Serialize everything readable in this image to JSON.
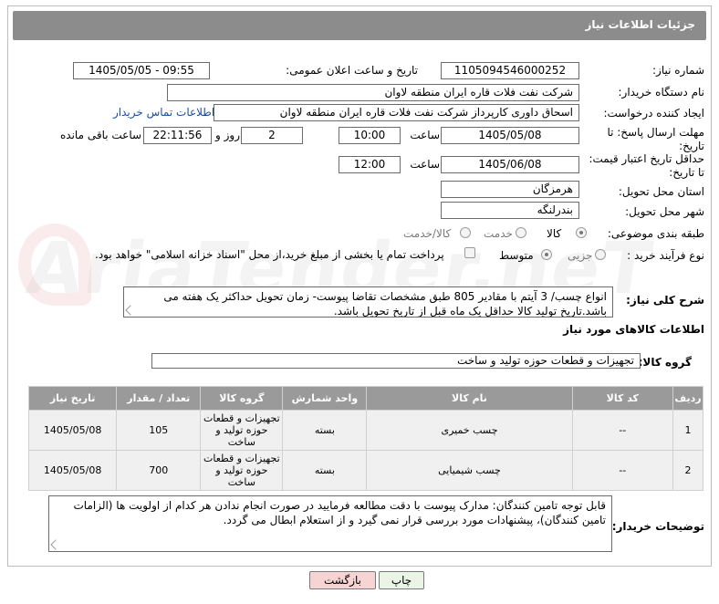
{
  "header": {
    "title": "جزئیات اطلاعات نیاز"
  },
  "labels": {
    "need_number": "شماره نیاز:",
    "announce_datetime": "تاریخ و ساعت اعلان عمومی:",
    "buyer_org": "نام دستگاه خریدار:",
    "requester": "ایجاد کننده درخواست:",
    "reply_deadline_l1": "مهلت ارسال پاسخ: تا",
    "reply_deadline_l2": "تاریخ:",
    "validity_l1": "حداقل تاریخ اعتبار قیمت:",
    "validity_l2": "تا تاریخ:",
    "time": "ساعت",
    "day_and": "روز و",
    "hours_left": "ساعت باقی مانده",
    "delivery_province": "استان محل تحویل:",
    "delivery_city": "شهر محل تحویل:",
    "category": "طبقه بندی موضوعی:",
    "purchase_type": "نوع فرآیند خرید :",
    "general_desc": "شرح کلی نیاز:",
    "goods_info": "اطلاعات کالاهای مورد نیاز",
    "goods_group": "گروه کالا:",
    "buyer_notes": "توضیحات خریدار:"
  },
  "values": {
    "need_number": "1105094546000252",
    "announce_datetime": "1405/05/05 - 09:55",
    "buyer_org": "شرکت نفت فلات قاره ایران منطقه لاوان",
    "requester": "اسحاق داوری کارپرداز شرکت نفت فلات قاره ایران منطقه لاوان",
    "buyer_contact_link": "اطلاعات تماس خریدار",
    "reply_date": "1405/05/08",
    "reply_time": "10:00",
    "reply_days": "2",
    "reply_remaining": "22:11:56",
    "validity_date": "1405/06/08",
    "validity_time": "12:00",
    "delivery_province": "هرمزگان",
    "delivery_city": "بندرلنگه",
    "goods_group": "تجهیزات و قطعات حوزه تولید و ساخت",
    "general_desc": "انواع چسب/ 3 آیتم با مقادیر 805 طبق مشخصات تقاضا پیوست- زمان تحویل حداکثر یک هفته می باشد.تاریخ تولید کالا حداقل یک ماه قبل از تاریخ تحویل باشد.",
    "buyer_notes": "قابل توجه تامین کنندگان: مدارک پیوست با دقت مطالعه فرمایید در صورت انجام ندادن هر کدام از اولویت ها (الزامات تامین کنندگان)، پیشنهادات مورد بررسی قرار نمی گیرد و از استعلام ابطال می گردد."
  },
  "category_options": [
    {
      "label": "کالا",
      "selected": true
    },
    {
      "label": "خدمت",
      "selected": false
    },
    {
      "label": "کالا/خدمت",
      "selected": false
    }
  ],
  "purchase_options": [
    {
      "label": "جزیی",
      "selected": false
    },
    {
      "label": "متوسط",
      "selected": true
    }
  ],
  "payment_note": "پرداخت تمام یا بخشی از مبلغ خرید،از محل \"اسناد خزانه اسلامی\" خواهد بود.",
  "table": {
    "headers": [
      "ردیف",
      "کد کالا",
      "نام کالا",
      "واحد شمارش",
      "گروه کالا",
      "تعداد / مقدار",
      "تاریخ نیاز"
    ],
    "rows": [
      {
        "row": "1",
        "code": "--",
        "name": "چسب خمیری",
        "unit": "بسته",
        "group": "تجهیزات و قطعات حوزه تولید و ساخت",
        "qty": "105",
        "date": "1405/05/08"
      },
      {
        "row": "2",
        "code": "--",
        "name": "چسب شیمیایی",
        "unit": "بسته",
        "group": "تجهیزات و قطعات حوزه تولید و ساخت",
        "qty": "700",
        "date": "1405/05/08"
      }
    ]
  },
  "buttons": {
    "print": "چاپ",
    "back": "بازگشت"
  },
  "watermark": "AriaTender.neT",
  "colors": {
    "header_bg": "#8c8c8c",
    "link": "#1a4fa0",
    "back_button_bg": "#f7d4d4",
    "print_button_bg": "#eaf5e6"
  }
}
